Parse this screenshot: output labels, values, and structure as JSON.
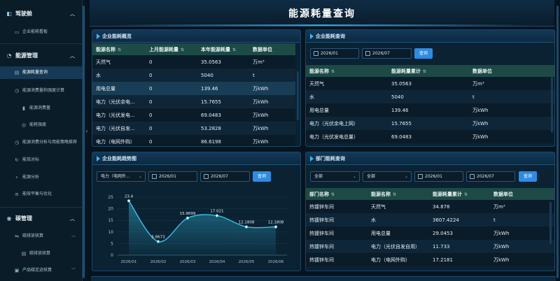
{
  "sidebar": {
    "section1": {
      "label": "驾驶舱",
      "icon": "dashboard-icon"
    },
    "item_dashboard": "企业能耗看板",
    "section2": {
      "label": "能源管理",
      "icon": "energy-icon"
    },
    "item_energy_query": "能源耗量查询",
    "item_energy_calc": "能源消费量和强度计算",
    "item_consumption": "能源消费量",
    "item_intensity": "能耗强度",
    "item_analysis": "能源消费分析与用能策略推荐",
    "item_benchmark": "能效对标",
    "item_energy_analysis": "能源分析",
    "item_balance": "能效平衡与优化",
    "section3": {
      "label": "碳管理",
      "icon": "carbon-icon"
    },
    "item_carbon_calc": "碳排放核算",
    "item_carbon_calc_sub": "碳排放核算",
    "item_product_footprint": "产品碳足迹核算"
  },
  "header": {
    "title": "能源耗量查询"
  },
  "overview": {
    "title": "企业能耗概览",
    "columns": [
      "能源名称",
      "上月能源耗量",
      "本年能源耗量",
      "数据单位"
    ],
    "rows": [
      [
        "天然气",
        "0",
        "35.0563",
        "万m³"
      ],
      [
        "水",
        "0",
        "5040",
        "t"
      ],
      [
        "用电总量",
        "0",
        "139.46",
        "万kWh"
      ],
      [
        "电力（光伏余电...",
        "0",
        "15.7655",
        "万kWh"
      ],
      [
        "电力（光伏发电...",
        "0",
        "69.0483",
        "万kWh"
      ],
      [
        "电力（光伏自发...",
        "0",
        "53.2828",
        "万kWh"
      ],
      [
        "电力（电网外购）",
        "0",
        "86.6198",
        "万kWh"
      ]
    ]
  },
  "query": {
    "title": "企业能耗查询",
    "start": "2026/01",
    "end": "2026/07",
    "button": "查询",
    "columns": [
      "能源名称",
      "能源耗量累计",
      "数据单位"
    ],
    "rows": [
      [
        "天然气",
        "35.0563",
        "万m³"
      ],
      [
        "水",
        "5040",
        "t"
      ],
      [
        "用电总量",
        "139.46",
        "万kWh"
      ],
      [
        "电力（光伏余电上网）",
        "15.7655",
        "万kWh"
      ],
      [
        "电力（光伏发电总量）",
        "69.0483",
        "万kWh"
      ]
    ]
  },
  "trend": {
    "title": "企业能耗趋势图",
    "select": "电力（电网外...",
    "start": "2026/01",
    "end": "2026/07",
    "button": "查询"
  },
  "dept": {
    "title": "部门能耗查询",
    "select1": "全部",
    "select2": "全部",
    "start": "2026/01",
    "end": "2026/07",
    "button": "查询",
    "columns": [
      "部门名称",
      "能源名称",
      "能源耗量累计",
      "数据单位"
    ],
    "rows": [
      [
        "热镀锌车间",
        "天然气",
        "34.878",
        "万m³"
      ],
      [
        "热镀锌车间",
        "水",
        "3607.4224",
        "t"
      ],
      [
        "热镀锌车间",
        "用电总量",
        "29.0453",
        "万kWh"
      ],
      [
        "热镀锌车间",
        "电力（光伏自发自用）",
        "11.733",
        "万kWh"
      ],
      [
        "热镀锌车间",
        "电力（电网外购）",
        "17.2181",
        "万kWh"
      ]
    ]
  },
  "chart_data": {
    "type": "area",
    "categories": [
      "2026/01",
      "2026/02",
      "2026/03",
      "2026/04",
      "2026/05",
      "2026/06"
    ],
    "values": [
      23.4,
      5.8673,
      15.9699,
      17.021,
      12.1808,
      12.1808
    ],
    "value_labels": [
      "23.4",
      "5.8673",
      "15.9699",
      "17.021",
      "12.1808",
      "12.1808"
    ],
    "y_ticks": [
      "0",
      "5",
      "10",
      "15",
      "20",
      "25"
    ],
    "ylim": [
      0,
      25
    ],
    "grid": true,
    "color": "#35c3e6"
  }
}
